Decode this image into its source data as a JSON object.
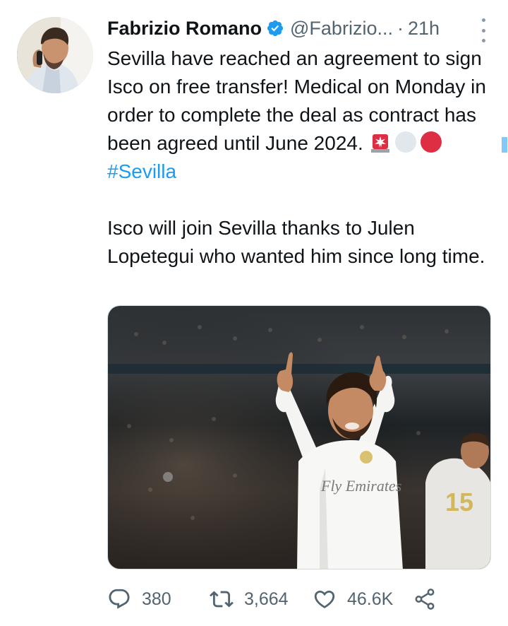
{
  "tweet": {
    "author_name": "Fabrizio Romano",
    "author_handle": "@Fabrizio...",
    "separator": "·",
    "time": "21h",
    "text_part1": "Sevilla have reached an agreement to sign Isco on free transfer! Medical on Monday in order to complete the deal as contract has been agreed until June 2024. ",
    "hashtag": "#Sevilla",
    "text_part2": "\n\nIsco will join Sevilla thanks to Julen Lopetegui who wanted him since long time.",
    "emojis": [
      "rotating-light-emoji",
      "white-circle-emoji",
      "red-circle-emoji"
    ],
    "media_description_icon": "photo-of-player-celebrating",
    "jersey_sponsor": "Fly Emirates",
    "jersey_number": "15"
  },
  "actions": {
    "reply_count": "380",
    "retweet_count": "3,664",
    "like_count": "46.6K",
    "reply_icon": "reply-icon",
    "retweet_icon": "retweet-icon",
    "like_icon": "heart-icon",
    "share_icon": "share-icon"
  },
  "colors": {
    "link": "#1d9bf0",
    "secondary_text": "#536471",
    "primary_text": "#0f1419",
    "verified": "#1d9bf0"
  }
}
